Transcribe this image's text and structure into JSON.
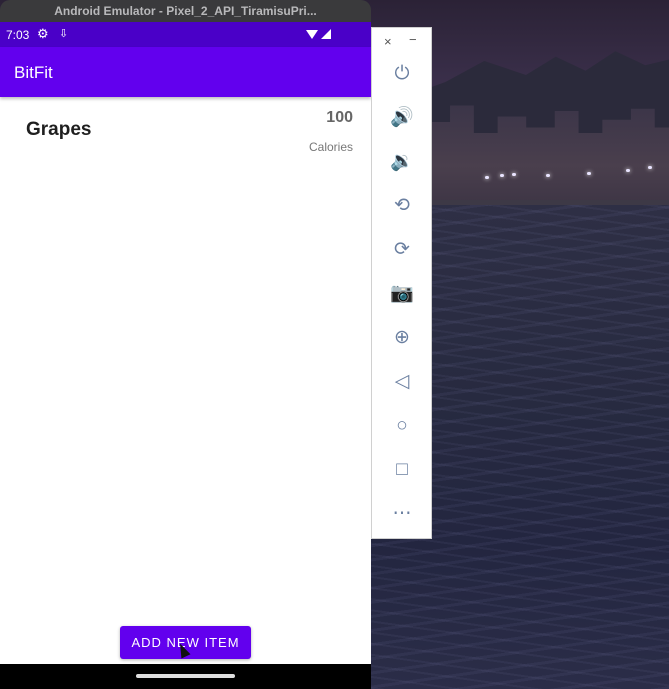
{
  "window": {
    "title": "Android Emulator - Pixel_2_API_TiramisuPri..."
  },
  "status_bar": {
    "time": "7:03",
    "icons": [
      "gear-icon",
      "download-icon",
      "wifi-icon",
      "signal-icon"
    ]
  },
  "app": {
    "title": "BitFit",
    "accent_color": "#6200ee",
    "status_color": "#4a00c8"
  },
  "items": [
    {
      "name": "Grapes",
      "calories": "100",
      "calories_label": "Calories"
    }
  ],
  "add_button": {
    "label": "ADD NEW ITEM"
  },
  "emulator_toolbar": {
    "close": "×",
    "minimize": "−",
    "buttons": [
      {
        "name": "power-icon",
        "glyph": "⏻"
      },
      {
        "name": "volume-up-icon",
        "glyph": "🔊"
      },
      {
        "name": "volume-down-icon",
        "glyph": "🔉"
      },
      {
        "name": "rotate-left-icon",
        "glyph": "⟲"
      },
      {
        "name": "rotate-right-icon",
        "glyph": "⟳"
      },
      {
        "name": "camera-icon",
        "glyph": "📷"
      },
      {
        "name": "zoom-icon",
        "glyph": "⊕"
      },
      {
        "name": "back-icon",
        "glyph": "◁"
      },
      {
        "name": "home-icon",
        "glyph": "○"
      },
      {
        "name": "overview-icon",
        "glyph": "□"
      },
      {
        "name": "more-icon",
        "glyph": "⋯"
      }
    ]
  }
}
